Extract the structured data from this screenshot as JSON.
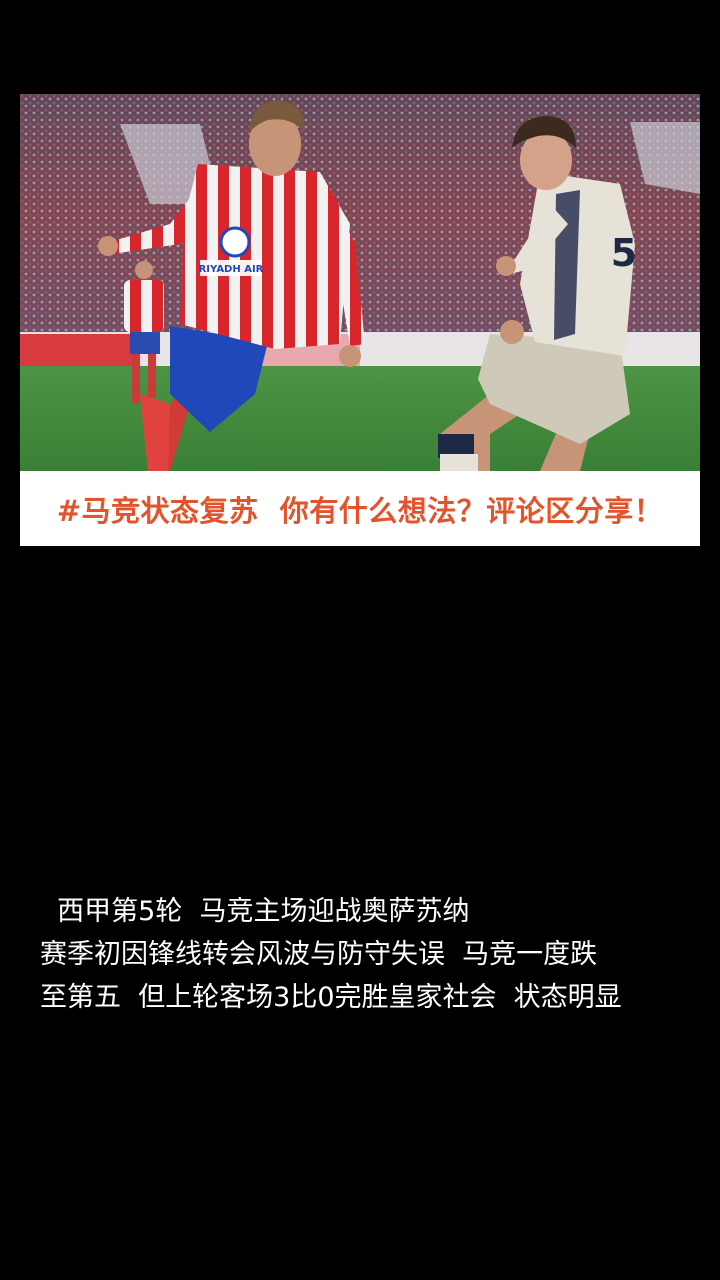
{
  "post": {
    "image_alt": "Football match action photo",
    "banner_text": "#马竞状态复苏  你有什么想法？评论区分享！",
    "jersey_sponsor": "RIYADH AIR",
    "opponent_number": "5",
    "caption_lines": [
      "  西甲第5轮  马竞主场迎战奥萨苏纳",
      "赛季初因锋线转会风波与防守失误  马竞一度跌",
      "至第五  但上轮客场3比0完胜皇家社会  状态明显"
    ]
  },
  "colors": {
    "background": "#000000",
    "banner_text": "#e4542c",
    "pitch": "#3f8a3a",
    "home_red": "#d8262c",
    "home_blue": "#1f48b8",
    "away_kit": "#e6e2d8"
  }
}
